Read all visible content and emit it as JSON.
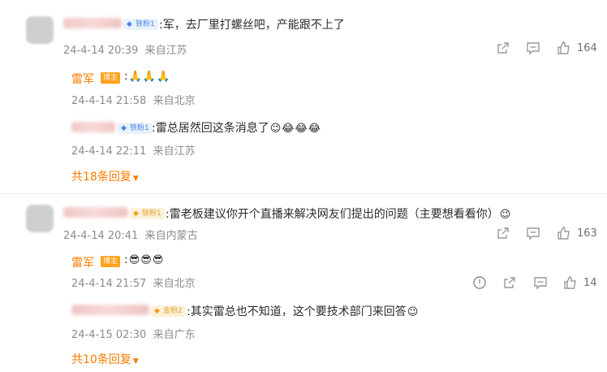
{
  "thread1": {
    "comment": {
      "fan_badge": "铁粉1",
      "text": ":军，去厂里打螺丝吧，产能跟不上了",
      "date": "24-4-14 20:39",
      "location": "来自江苏",
      "likes": "164"
    },
    "replies": [
      {
        "author": "雷军",
        "badge": "博主",
        "text": ":",
        "emojis": [
          "🙏",
          "🙏",
          "🙏"
        ],
        "date": "24-4-14 21:58",
        "location": "来自北京"
      },
      {
        "fan_badge": "铁粉1",
        "text": ":雷总居然回这条消息了",
        "emojis": [
          "😉",
          "😂",
          "😂",
          "😂"
        ],
        "date": "24-4-14 22:11",
        "location": "来自江苏"
      }
    ],
    "more_replies": "共18条回复"
  },
  "thread2": {
    "comment": {
      "fan_badge": "铁粉1",
      "text": ":雷老板建议你开个直播来解决网友们提出的问题（主要想看看你）",
      "emojis": [
        "😉"
      ],
      "date": "24-4-14 20:41",
      "location": "来自内蒙古",
      "likes": "163"
    },
    "replies": [
      {
        "author": "雷军",
        "badge": "博主",
        "text": ":",
        "emojis": [
          "😎",
          "😎",
          "😎"
        ],
        "date": "24-4-14 21:57",
        "location": "来自北京",
        "likes": "14"
      },
      {
        "fan_badge": "金粉2",
        "text": ":其实雷总也不知道，这个要技术部门来回答",
        "emojis": [
          "😉"
        ],
        "date": "24-4-15 02:30",
        "location": "来自广东"
      }
    ],
    "more_replies": "共10条回复"
  },
  "icons": {
    "share": "share-icon",
    "comment": "comment-icon",
    "like": "thumbs-up-icon",
    "report": "report-icon",
    "expand": "caret-down-icon"
  },
  "colors": {
    "author": "#ff7a00",
    "meta": "#8c8c8c",
    "badge_blue": "#4a86e8",
    "badge_orange": "#ffa21a"
  }
}
